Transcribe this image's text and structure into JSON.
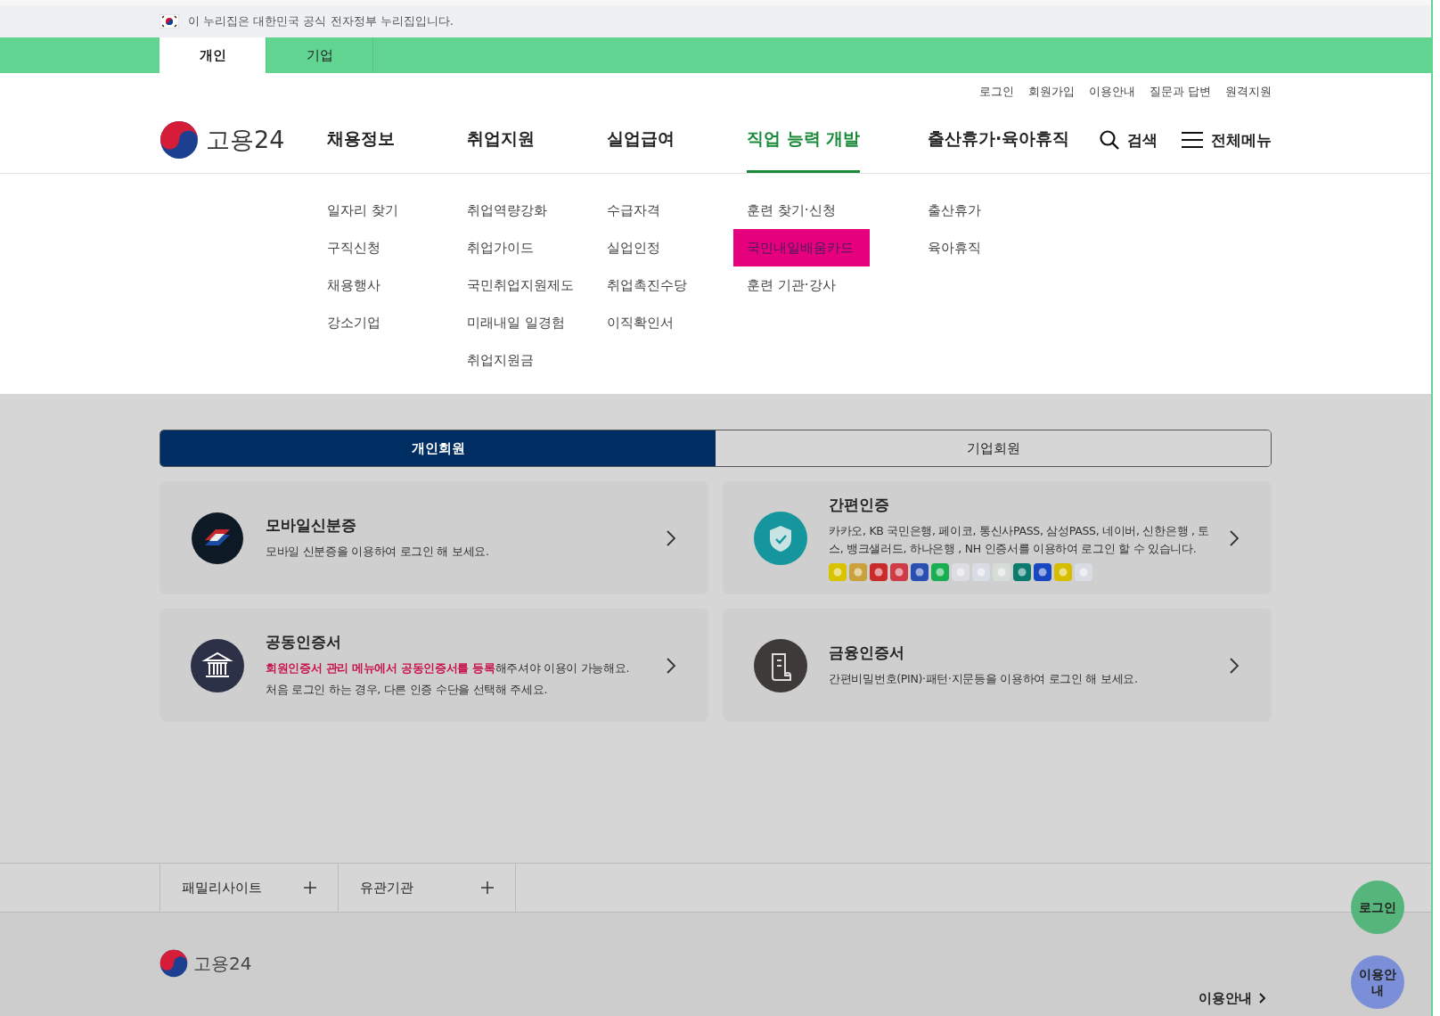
{
  "gov_banner": {
    "text": "이 누리집은 대한민국 공식 전자정부 누리집입니다."
  },
  "audience_tabs": [
    {
      "label": "개인",
      "selected": true
    },
    {
      "label": "기업",
      "selected": false
    }
  ],
  "utility_links": [
    "로그인",
    "회원가입",
    "이용안내",
    "질문과 답변",
    "원격지원"
  ],
  "logo": {
    "text": "고용24"
  },
  "nav": [
    {
      "label": "채용정보",
      "selected": false,
      "submenu": [
        {
          "label": "일자리 찾기",
          "selected": false
        },
        {
          "label": "구직신청",
          "selected": false
        },
        {
          "label": "채용행사",
          "selected": false
        },
        {
          "label": "강소기업",
          "selected": false
        }
      ]
    },
    {
      "label": "취업지원",
      "selected": false,
      "submenu": [
        {
          "label": "취업역량강화",
          "selected": false
        },
        {
          "label": "취업가이드",
          "selected": false
        },
        {
          "label": "국민취업지원제도",
          "selected": false
        },
        {
          "label": "미래내일 일경험",
          "selected": false
        },
        {
          "label": "취업지원금",
          "selected": false
        }
      ]
    },
    {
      "label": "실업급여",
      "selected": false,
      "submenu": [
        {
          "label": "수급자격",
          "selected": false
        },
        {
          "label": "실업인정",
          "selected": false
        },
        {
          "label": "취업촉진수당",
          "selected": false
        },
        {
          "label": "이직확인서",
          "selected": false
        }
      ]
    },
    {
      "label": "직업 능력 개발",
      "selected": true,
      "submenu": [
        {
          "label": "훈련 찾기·신청",
          "selected": false
        },
        {
          "label": "국민내일배움카드",
          "selected": true
        },
        {
          "label": "훈련 기관·강사",
          "selected": false
        }
      ]
    },
    {
      "label": "출산휴가·육아휴직",
      "selected": false,
      "submenu": [
        {
          "label": "출산휴가",
          "selected": false
        },
        {
          "label": "육아휴직",
          "selected": false
        }
      ]
    }
  ],
  "search": {
    "label": "검색"
  },
  "all_menu": {
    "label": "전체메뉴"
  },
  "member_tabs": [
    {
      "label": "개인회원",
      "selected": true
    },
    {
      "label": "기업회원",
      "selected": false
    }
  ],
  "login_methods": [
    {
      "kind": "mobile-id",
      "title": "모바일신분증",
      "lines": [
        [
          {
            "text": "모바일 신분증을 이용하여 로그인 해 보세요.",
            "emphasis": false
          }
        ]
      ]
    },
    {
      "kind": "simple-auth",
      "title": "간편인증",
      "lines": [
        [
          {
            "text": "카카오, KB 국민은행, 페이코, 통신사PASS, 삼성PASS, 네이버, 신한은행 , 토스, 뱅크샐러드, 하나은행 , NH 인증서를 이용하여 로그인 할 수 있습니다.",
            "emphasis": false
          }
        ]
      ],
      "provider_logos": [
        {
          "color": "#d9c200"
        },
        {
          "color": "#c9a23e"
        },
        {
          "color": "#c92a2a"
        },
        {
          "color": "#cf3b47"
        },
        {
          "color": "#2a4fb0"
        },
        {
          "color": "#1aae52"
        },
        {
          "color": "#dcdce2"
        },
        {
          "color": "#d8dce4"
        },
        {
          "color": "#d6dcd8"
        },
        {
          "color": "#0b7b6e"
        },
        {
          "color": "#1a47c0"
        },
        {
          "color": "#d6bd00"
        },
        {
          "color": "#dadce4"
        }
      ]
    },
    {
      "kind": "joint-cert",
      "title": "공동인증서",
      "lines": [
        [
          {
            "text": "회원인증서 관리 메뉴에서 공동인증서를 등록",
            "emphasis": true
          },
          {
            "text": "해주셔야 이용이 가능해요.",
            "emphasis": false
          }
        ],
        [
          {
            "text": "처음 로그인 하는 경우, 다른 인증 수단을 선택해 주세요.",
            "emphasis": false
          }
        ]
      ]
    },
    {
      "kind": "financial-cert",
      "title": "금융인증서",
      "lines": [
        [
          {
            "text": "간편비밀번호(PIN)·패턴·지문등을 이용하여 로그인 해 보세요.",
            "emphasis": false
          }
        ]
      ]
    }
  ],
  "footer_tabs": [
    {
      "label": "패밀리사이트"
    },
    {
      "label": "유관기관"
    }
  ],
  "footer": {
    "logo_text": "고용24",
    "guide_link": "이용안내"
  },
  "floating_buttons": [
    {
      "label": "로그인",
      "color": "#55b57a"
    },
    {
      "label": "이용안내",
      "color": "#7b8fd8"
    }
  ]
}
